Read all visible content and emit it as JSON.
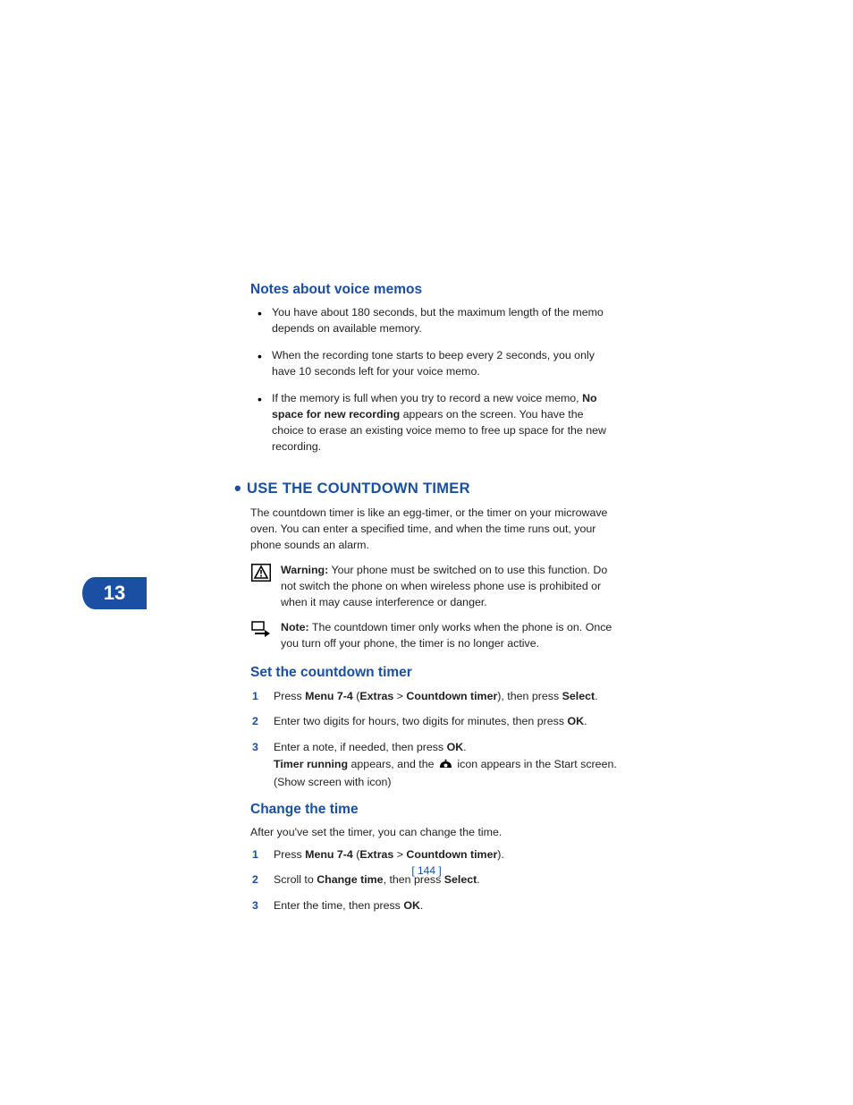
{
  "colors": {
    "accent": "#1a4fa3"
  },
  "chapter_number": "13",
  "page_number": "[ 144 ]",
  "h_notes": "Notes about voice memos",
  "notes_bullets": [
    "You have about 180 seconds, but the maximum length of the memo depends on available memory.",
    "When the recording tone starts to beep every 2 seconds, you only have 10 seconds left for your voice memo."
  ],
  "notes_bullet3_a": "If the memory is full when you try to record a new voice memo, ",
  "notes_bullet3_b": "No space for new recording",
  "notes_bullet3_c": " appears on the screen. You have the choice to erase an existing voice memo to free up space for the new recording.",
  "h_section": "USE THE COUNTDOWN TIMER",
  "section_intro": "The countdown timer is like an egg-timer, or the timer on your microwave oven. You can enter a specified time, and when the time runs out, your phone sounds an alarm.",
  "warning_label": "Warning:",
  "warning_text": "  Your phone must be switched on to use this function. Do not switch the phone on when wireless phone use is prohibited or when it may cause interference or danger.",
  "note_label": "Note:",
  "note_text": " The countdown timer only works when the phone is on. Once you turn off your phone, the timer is no longer active.",
  "h_set": "Set the countdown timer",
  "set_steps": {
    "s1_a": "Press ",
    "s1_b": "Menu 7-4",
    "s1_c": " (",
    "s1_d": "Extras",
    "s1_e": " > ",
    "s1_f": "Countdown timer",
    "s1_g": "), then press ",
    "s1_h": "Select",
    "s1_i": ".",
    "s2_a": "Enter two digits for hours, two digits for minutes, then press ",
    "s2_b": "OK",
    "s2_c": ".",
    "s3_a": "Enter a note, if needed, then press ",
    "s3_b": "OK",
    "s3_c": ".",
    "s3_d": "Timer running",
    "s3_e": " appears, and the ",
    "s3_f": " icon appears in the Start screen. (Show screen with icon)"
  },
  "h_change": "Change the time",
  "change_intro": "After you've set the timer, you can change the time.",
  "change_steps": {
    "c1_a": "Press ",
    "c1_b": "Menu 7-4",
    "c1_c": " (",
    "c1_d": "Extras",
    "c1_e": " > ",
    "c1_f": "Countdown timer",
    "c1_g": ").",
    "c2_a": "Scroll to ",
    "c2_b": "Change time",
    "c2_c": ", then press ",
    "c2_d": "Select",
    "c2_e": ".",
    "c3_a": "Enter the time, then press ",
    "c3_b": "OK",
    "c3_c": "."
  },
  "icons": {
    "warning": "warning-icon",
    "note": "note-arrow-icon",
    "timer": "timer-icon"
  }
}
